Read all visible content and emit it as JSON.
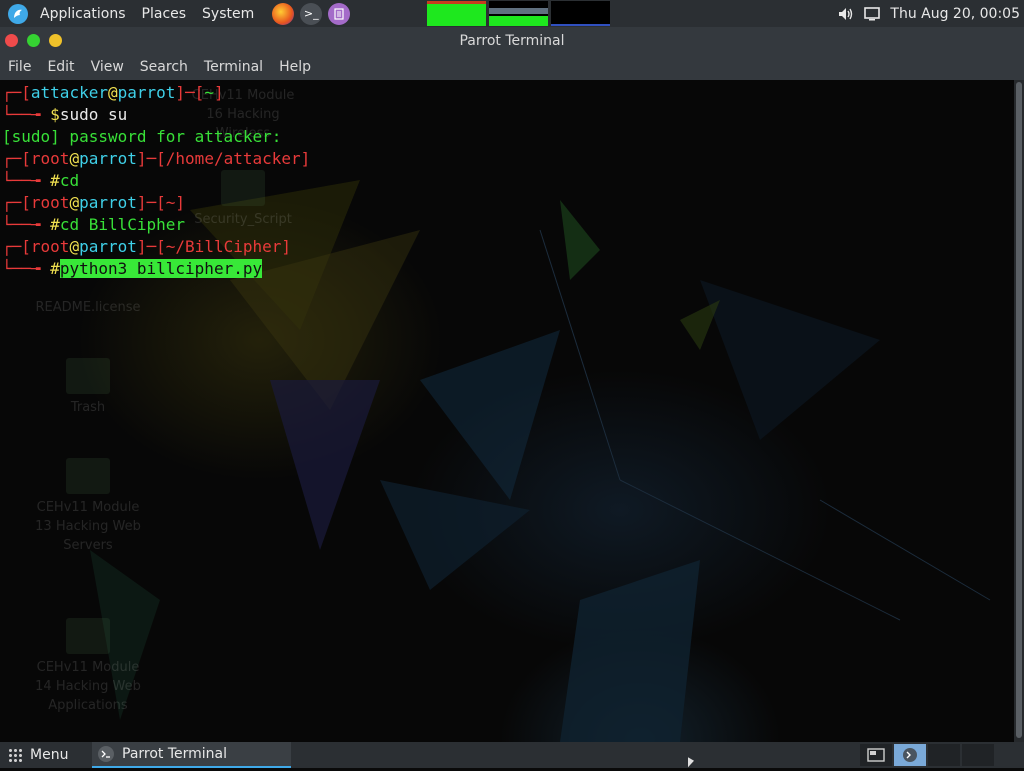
{
  "top_panel": {
    "menus": [
      "Applications",
      "Places",
      "System"
    ],
    "launchers": [
      {
        "name": "firefox-icon"
      },
      {
        "name": "terminal-icon",
        "glyph": ">_"
      },
      {
        "name": "text-editor-icon"
      }
    ],
    "clock": "Thu Aug 20, 00:05",
    "tray": [
      "volume-icon",
      "display-icon"
    ]
  },
  "window": {
    "title": "Parrot Terminal",
    "menu": [
      "File",
      "Edit",
      "View",
      "Search",
      "Terminal",
      "Help"
    ]
  },
  "terminal": {
    "sessions": [
      {
        "user": "attacker",
        "host": "parrot",
        "path": "~",
        "symbol": "$",
        "command": "sudo su"
      },
      {
        "output": "[sudo] password for attacker:"
      },
      {
        "user": "root",
        "host": "parrot",
        "path": "/home/attacker",
        "symbol": "#",
        "command": "cd"
      },
      {
        "user": "root",
        "host": "parrot",
        "path": "~",
        "symbol": "#",
        "command": "cd BillCipher"
      },
      {
        "user": "root",
        "host": "parrot",
        "path": "~/BillCipher",
        "symbol": "#",
        "command": "python3 billcipher.py"
      }
    ]
  },
  "desktop_icons": [
    {
      "label": "CEHv11 Module 16 Hacking Wireless"
    },
    {
      "label": "Security_Script"
    },
    {
      "label": "README.license"
    },
    {
      "label": "Trash"
    },
    {
      "label": "CEHv11 Module 13 Hacking Web Servers"
    },
    {
      "label": "CEHv11 Module 14 Hacking Web Applications"
    }
  ],
  "taskbar": {
    "menu_label": "Menu",
    "task": "Parrot Terminal"
  },
  "colors": {
    "prompt_bracket": "#e83a3a",
    "prompt_user": "#3fd0e8",
    "prompt_at": "#f0e050",
    "prompt_path": "#e83a3a",
    "output": "#38e038",
    "selection": "#38e838"
  }
}
